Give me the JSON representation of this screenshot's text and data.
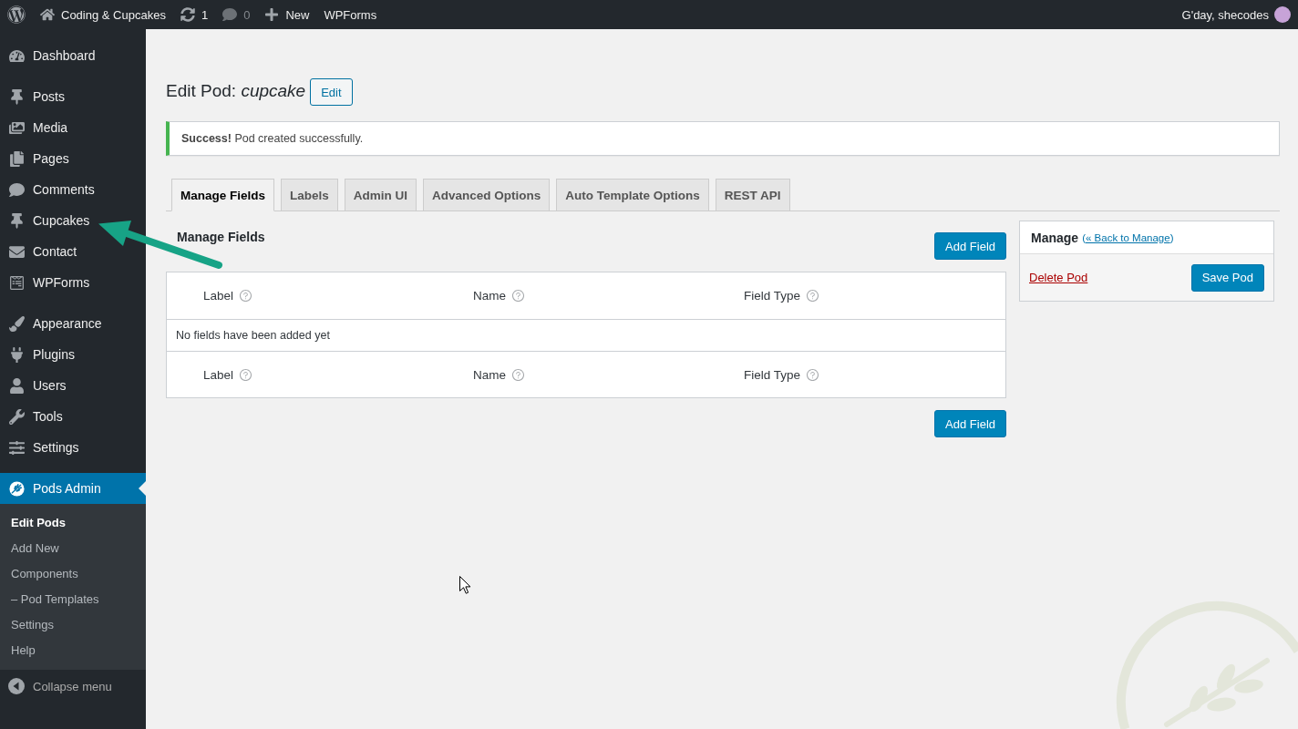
{
  "admin_bar": {
    "items": [
      {
        "kind": "site",
        "label": "Coding & Cupcakes",
        "dimmed": false
      },
      {
        "kind": "updates",
        "label": "1",
        "dimmed": false
      },
      {
        "kind": "comments",
        "label": "0",
        "dimmed": true
      },
      {
        "kind": "new",
        "label": "New",
        "dimmed": false
      },
      {
        "kind": "link",
        "label": "WPForms",
        "dimmed": false
      }
    ],
    "greeting": "G'day, shecodes"
  },
  "sidebar": {
    "sections": [
      {
        "items": [
          {
            "label": "Dashboard",
            "selected": false
          }
        ]
      },
      {
        "items": [
          {
            "label": "Posts",
            "selected": false
          },
          {
            "label": "Media",
            "selected": false
          },
          {
            "label": "Pages",
            "selected": false
          },
          {
            "label": "Comments",
            "selected": false
          },
          {
            "label": "Cupcakes",
            "selected": false
          },
          {
            "label": "Contact",
            "selected": false
          },
          {
            "label": "WPForms",
            "selected": false
          }
        ]
      },
      {
        "items": [
          {
            "label": "Appearance",
            "selected": false
          },
          {
            "label": "Plugins",
            "selected": false
          },
          {
            "label": "Users",
            "selected": false
          },
          {
            "label": "Tools",
            "selected": false
          },
          {
            "label": "Settings",
            "selected": false
          }
        ]
      },
      {
        "items": [
          {
            "label": "Pods Admin",
            "selected": true,
            "submenu": [
              {
                "label": "Edit Pods",
                "selected": true
              },
              {
                "label": "Add New",
                "selected": false
              },
              {
                "label": "Components",
                "selected": false
              },
              {
                "label": "– Pod Templates",
                "selected": false
              },
              {
                "label": "Settings",
                "selected": false
              },
              {
                "label": "Help",
                "selected": false
              }
            ]
          }
        ]
      }
    ],
    "collapse": "Collapse menu"
  },
  "page": {
    "title": "Edit Pod: *cupcake*",
    "edit_button": "Edit",
    "notice": "**Success!** Pod created successfully.",
    "tabs": [
      {
        "label": "Manage Fields",
        "selected": true
      },
      {
        "label": "Labels",
        "selected": false
      },
      {
        "label": "Admin UI",
        "selected": false
      },
      {
        "label": "Advanced Options",
        "selected": false
      },
      {
        "label": "Auto Template Options",
        "selected": false
      },
      {
        "label": "REST API",
        "selected": false
      }
    ],
    "fields": {
      "title": "Manage Fields",
      "add_button_top": "Add Field",
      "header_columns": [
        "Label",
        "Name",
        "Field Type"
      ],
      "empty_message": "No fields have been added yet",
      "footer_columns": [
        "Label",
        "Name",
        "Field Type"
      ],
      "add_button_bottom": "Add Field"
    },
    "manage_box": {
      "title": "Manage",
      "back_link": {
        "open": "(",
        "label": "« Back to Manage",
        "close": ")"
      },
      "delete_link": "Delete Pod",
      "save_button": "Save Pod"
    }
  }
}
